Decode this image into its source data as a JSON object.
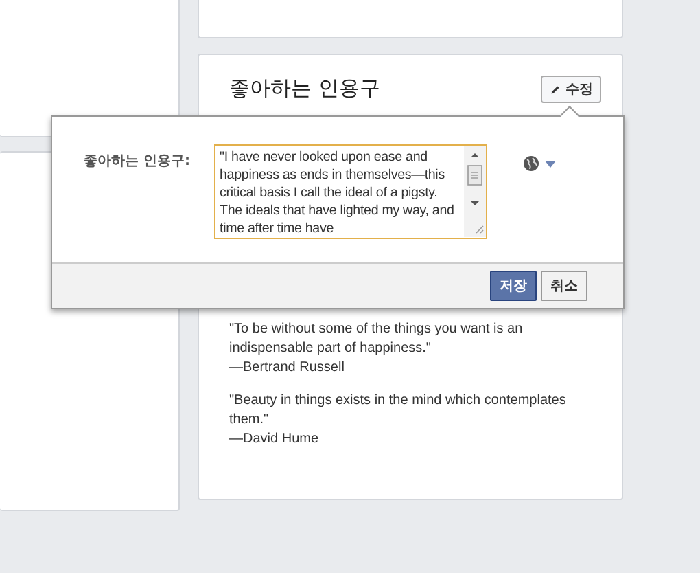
{
  "quote_card": {
    "title": "좋아하는 인용구",
    "edit_button": "수정",
    "quotes": [
      {
        "text": "\"To be without some of the things you want is an indispensable part of happiness.\"",
        "author": "—Bertrand Russell"
      },
      {
        "text": "\"Beauty in things exists in the mind which contemplates them.\"",
        "author": "—David Hume"
      }
    ]
  },
  "edit_popup": {
    "label": "좋아하는 인용구:",
    "value": "\"I have never looked upon ease and happiness as ends in themselves—this critical basis I call the ideal of a pigsty. The ideals that have lighted my way, and time after time have",
    "buttons": [
      {
        "label": "저장",
        "kind": "primary"
      },
      {
        "label": "취소",
        "kind": "secondary"
      }
    ]
  }
}
